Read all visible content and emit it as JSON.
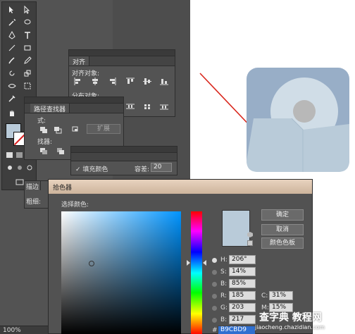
{
  "panels": {
    "align": {
      "tab": "对齐",
      "align_objects_label": "对齐对象:",
      "distribute_objects_label": "分布对象:"
    },
    "pathfinder": {
      "tab": "路径查找器",
      "shape_modes_label": "式:",
      "pathfinders_label": "找器:",
      "expand_label": "扩展"
    },
    "magic_wand": {
      "fill_color_label": "填充颜色",
      "tolerance_label": "容差:",
      "tolerance_value": "20"
    },
    "stroke": {
      "tab": "描边",
      "weight_label": "粗细:"
    }
  },
  "status": {
    "zoom": "100%"
  },
  "color_picker": {
    "title": "拾色器",
    "select_color_label": "选择颜色:",
    "ok_label": "确定",
    "cancel_label": "取消",
    "swatches_label": "颜色色板",
    "fields": {
      "h_label": "H:",
      "h_value": "206°",
      "s_label": "S:",
      "s_value": "14%",
      "b_label": "B:",
      "b_value": "85%",
      "r_label": "R:",
      "r_value": "185",
      "g_label": "G:",
      "g_value": "203",
      "blue_label": "B:",
      "blue_value": "217",
      "c_label": "C:",
      "c_value": "31%",
      "m_label": "M:",
      "m_value": "15%",
      "hex_label": "#",
      "hex_value": "B9CBD9"
    },
    "current_color": "#B9CBD9"
  },
  "watermark": {
    "title": "查字典 教程网",
    "url": "jiaocheng.chazidian.com"
  },
  "colors": {
    "accent_arrow": "#d9261c",
    "artwork_bg": "#98aec7",
    "artwork_light": "#B9CBD9"
  }
}
